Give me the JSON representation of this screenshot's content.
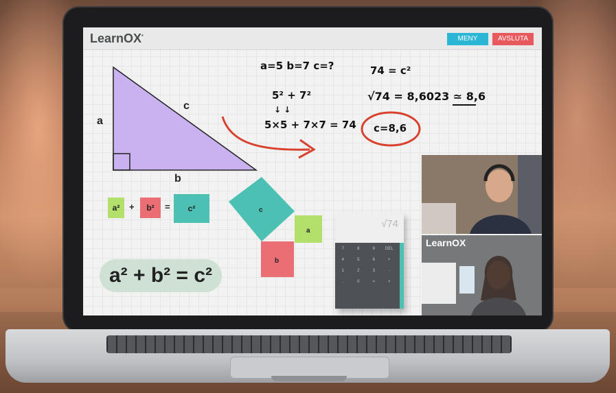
{
  "app": {
    "logo": "LearnOX",
    "logo_mark": "*"
  },
  "header": {
    "menu_label": "MENY",
    "exit_label": "AVSLUTA"
  },
  "triangle": {
    "side_a": "a",
    "side_b": "b",
    "side_c": "c"
  },
  "formula_small": {
    "a": "a²",
    "plus": "+",
    "b": "b²",
    "equals": "=",
    "c": "c²"
  },
  "formula_big": "a² + b² = c²",
  "squares": {
    "c": "c",
    "a": "a",
    "b": "b"
  },
  "handwriting": {
    "given": "a=5   b=7   c=?",
    "powers": "5² + 7²",
    "arrows": "↓        ↓",
    "products": "5×5 + 7×7 = 74",
    "c_squared": "74 = c²",
    "sqrt": "√74 = 8,6023 ≃ 8,6",
    "result": "c=8,6"
  },
  "calculator": {
    "display": "√74",
    "keys": [
      "7",
      "8",
      "9",
      "DEL",
      "4",
      "5",
      "6",
      "+",
      "1",
      "2",
      "3",
      "-",
      ".",
      "0",
      "=",
      "×"
    ]
  },
  "video": {
    "tutor_logo": "LearnOX"
  },
  "colors": {
    "menu_button": "#2bb6d6",
    "exit_button": "#e8595e",
    "triangle": "#c9b2ef",
    "square_c": "#4cc0b3",
    "square_a": "#b3e06a",
    "square_b": "#ea6e73",
    "handwriting_red": "#d9412e"
  }
}
